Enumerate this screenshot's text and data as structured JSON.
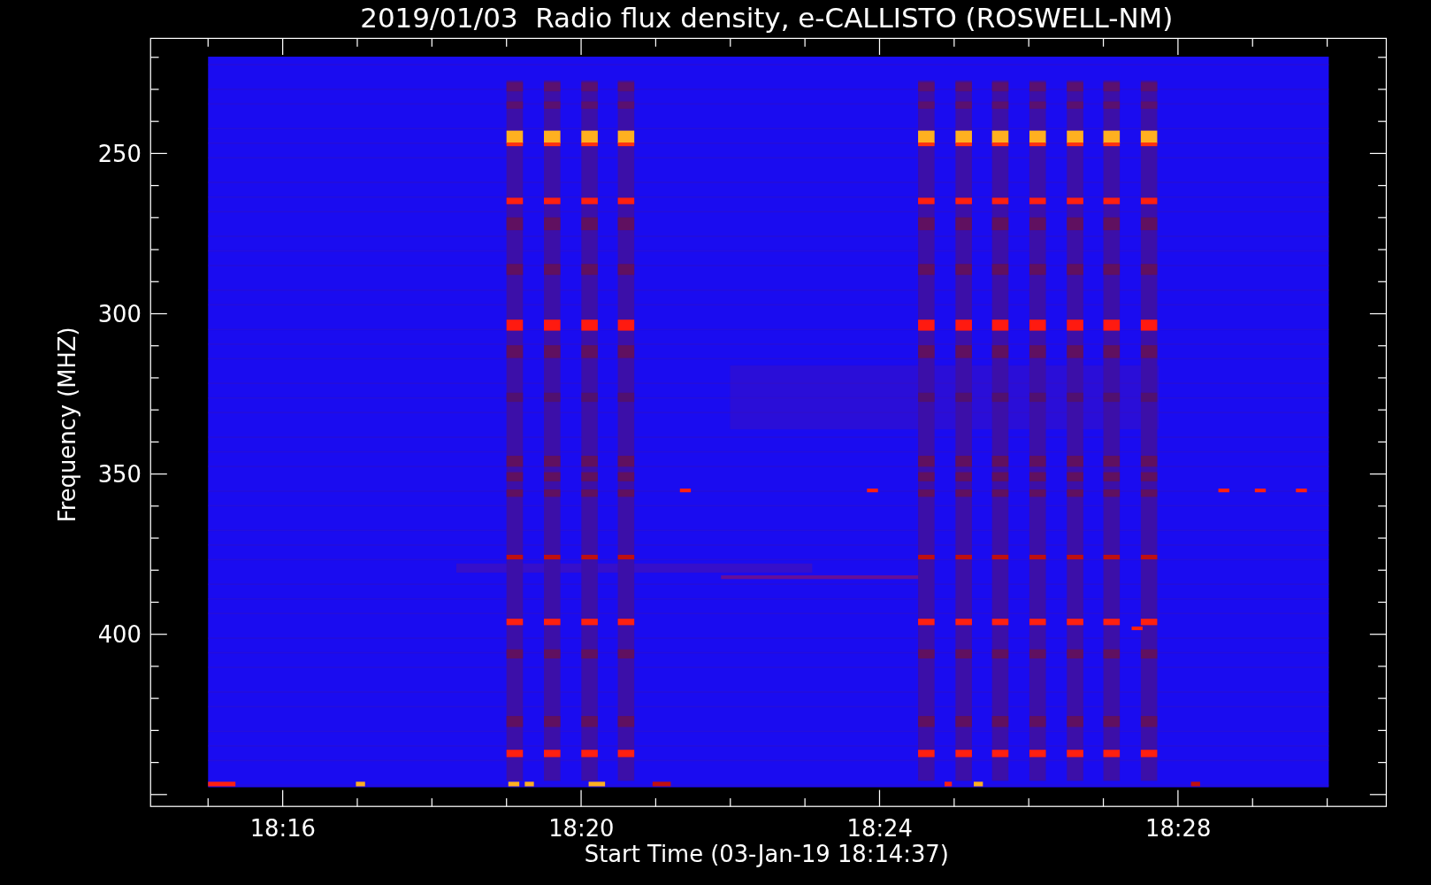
{
  "title": "2019/01/03  Radio flux density, e-CALLISTO (ROSWELL-NM)",
  "y_axis": {
    "label": "Frequency (MHZ)",
    "ticks": [
      "250",
      "300",
      "350",
      "400"
    ]
  },
  "x_axis": {
    "label": "Start Time (03-Jan-19 18:14:37)",
    "ticks": [
      "18:16",
      "18:20",
      "18:24",
      "18:28"
    ]
  }
}
